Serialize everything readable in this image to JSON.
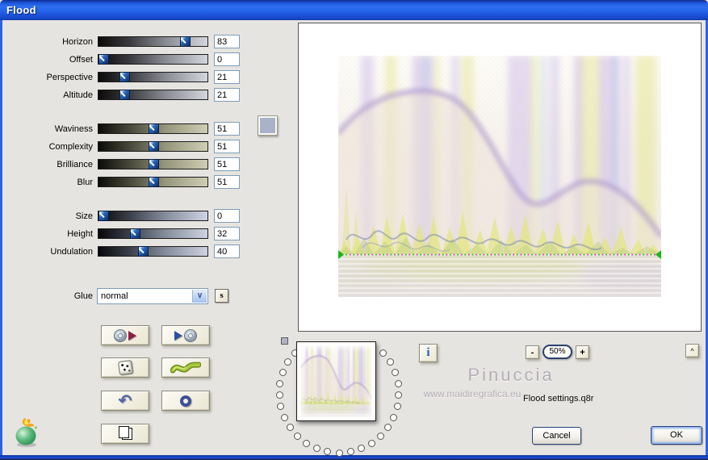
{
  "window": {
    "title": "Flood"
  },
  "sliders": [
    {
      "label": "Horizon",
      "value": "83",
      "group": "neutral"
    },
    {
      "label": "Offset",
      "value": "0",
      "group": "neutral"
    },
    {
      "label": "Perspective",
      "value": "21",
      "group": "neutral"
    },
    {
      "label": "Altitude",
      "value": "21",
      "group": "neutral"
    },
    {
      "label": "Waviness",
      "value": "51",
      "group": "khaki"
    },
    {
      "label": "Complexity",
      "value": "51",
      "group": "khaki"
    },
    {
      "label": "Brilliance",
      "value": "51",
      "group": "khaki"
    },
    {
      "label": "Blur",
      "value": "51",
      "group": "khaki"
    },
    {
      "label": "Size",
      "value": "0",
      "group": "steel"
    },
    {
      "label": "Height",
      "value": "32",
      "group": "steel"
    },
    {
      "label": "Undulation",
      "value": "40",
      "group": "steel"
    }
  ],
  "glue": {
    "label": "Glue",
    "selected": "normal"
  },
  "s_button_label": "s",
  "icon_buttons": [
    {
      "name": "load-preset-button",
      "icon": "cd-red-arrow-icon"
    },
    {
      "name": "save-preset-button",
      "icon": "blue-arrow-cd-icon"
    },
    {
      "name": "randomize-button",
      "icon": "dice-icon"
    },
    {
      "name": "wave-button",
      "icon": "green-wave-icon"
    },
    {
      "name": "undo-button",
      "icon": "undo-arrow-icon",
      "glyph": "↶"
    },
    {
      "name": "reset-button",
      "icon": "ring-icon"
    },
    {
      "name": "copy-settings-button",
      "icon": "documents-icon"
    }
  ],
  "info_button_label": "i",
  "zoom_controls": {
    "minus": "-",
    "level": "50%",
    "plus": "+"
  },
  "collapse_button_label": "^",
  "watermark": {
    "name": "Pinuccia",
    "url": "www.maidiregrafica.eu"
  },
  "settings_file": "Flood settings.q8r",
  "actions": {
    "cancel": "Cancel",
    "ok": "OK"
  },
  "memory_ring": {
    "dot_count": 25
  },
  "colors": {
    "swatch": "#a9b2c8",
    "titlebar_blue": "#2363ea",
    "horizon_dot_green": "#1fc41f",
    "horizon_dot_magenta": "#ef2fd0",
    "slider_thumb_blue": "#1b4e9b"
  }
}
